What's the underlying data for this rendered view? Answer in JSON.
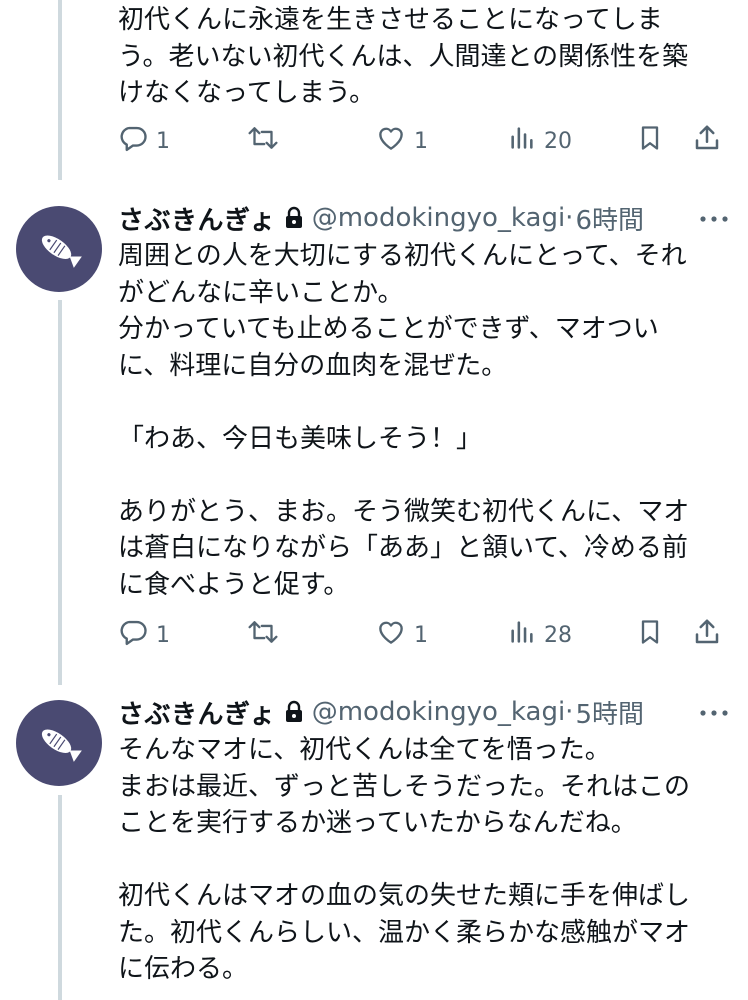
{
  "tweets": [
    {
      "body": "初代くんに永遠を生きさせることになってしま\nう。老いない初代くんは、人間達との関係性を築\nけなくなってしまう。",
      "replies": "1",
      "likes": "1",
      "views": "20"
    },
    {
      "name": "さぶきんぎょ",
      "handle": "@modokingyo_kagi",
      "dot": "·",
      "time": "6時間",
      "body": "周囲との人を大切にする初代くんにとって、それ\nがどんなに辛いことか。\n分かっていても止めることができず、マオつい\nに、料理に自分の血肉を混ぜた。\n\n「わあ、今日も美味しそう！」\n\nありがとう、まお。そう微笑む初代くんに、マオ\nは蒼白になりながら「ああ」と頷いて、冷める前\nに食べようと促す。",
      "replies": "1",
      "likes": "1",
      "views": "28"
    },
    {
      "name": "さぶきんぎょ",
      "handle": "@modokingyo_kagi",
      "dot": "·",
      "time": "5時間",
      "body": "そんなマオに、初代くんは全てを悟った。\nまおは最近、ずっと苦しそうだった。それはこの\nことを実行するか迷っていたからなんだね。\n\n初代くんはマオの血の気の失せた頬に手を伸ばし\nた。初代くんらしい、温かく柔らかな感触がマオ\nに伝わる。"
    }
  ],
  "icons": {
    "reply": "reply-icon",
    "retweet": "retweet-icon",
    "like": "heart-icon",
    "views": "views-icon",
    "bookmark": "bookmark-icon",
    "share": "share-icon",
    "more": "more-icon",
    "lock": "lock-icon",
    "avatar": "fish-icon"
  },
  "colors": {
    "text": "#0f1419",
    "muted": "#536471",
    "thread_line": "#cfd9de",
    "avatar_bg": "#4a4a72"
  }
}
